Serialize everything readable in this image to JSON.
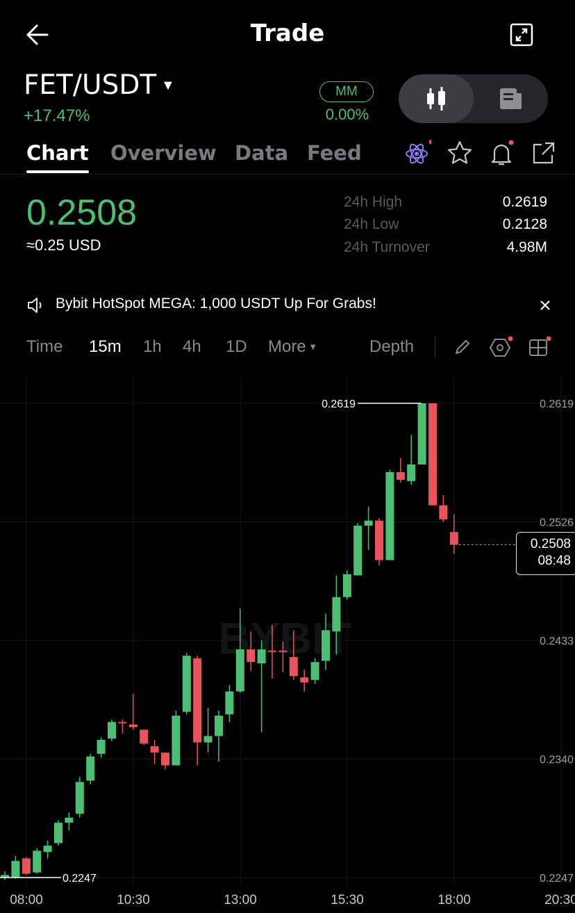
{
  "header": {
    "title": "Trade"
  },
  "pair": {
    "symbol": "FET/USDT",
    "change": "+17.47%"
  },
  "mm": {
    "label": "MM",
    "value": "0.00%"
  },
  "tabs": [
    "Chart",
    "Overview",
    "Data",
    "Feed"
  ],
  "price": {
    "last": "0.2508",
    "usd": "≈0.25 USD"
  },
  "stats": [
    {
      "label": "24h High",
      "value": "0.2619"
    },
    {
      "label": "24h Low",
      "value": "0.2128"
    },
    {
      "label": "24h Turnover",
      "value": "4.98M"
    }
  ],
  "announcement": "Bybit HotSpot MEGA: 1,000 USDT Up For Grabs!",
  "timeframes": {
    "time": "Time",
    "m15": "15m",
    "h1": "1h",
    "h4": "4h",
    "d1": "1D",
    "more": "More",
    "depth": "Depth"
  },
  "colors": {
    "up": "#4cbf73",
    "down": "#e9545c",
    "bg": "#000000"
  },
  "chart_data": {
    "type": "candlestick",
    "interval": "15m",
    "watermark": "BYBIT",
    "y_ticks": [
      "0.2619",
      "0.2526",
      "0.2433",
      "0.2340",
      "0.2247"
    ],
    "ylim": [
      0.2247,
      0.2619
    ],
    "x_ticks": [
      "08:00",
      "10:30",
      "13:00",
      "15:30",
      "18:00",
      "20:30"
    ],
    "high_marker": "0.2619",
    "low_marker": "0.2247",
    "current_price": "0.2508",
    "countdown": "08:48",
    "candles": [
      {
        "o": 0.2247,
        "h": 0.2252,
        "l": 0.2245,
        "c": 0.2249
      },
      {
        "o": 0.2247,
        "h": 0.2264,
        "l": 0.2246,
        "c": 0.226
      },
      {
        "o": 0.2262,
        "h": 0.2263,
        "l": 0.2249,
        "c": 0.225
      },
      {
        "o": 0.2251,
        "h": 0.227,
        "l": 0.225,
        "c": 0.2268
      },
      {
        "o": 0.2267,
        "h": 0.2276,
        "l": 0.2262,
        "c": 0.2272
      },
      {
        "o": 0.2274,
        "h": 0.2292,
        "l": 0.2272,
        "c": 0.229
      },
      {
        "o": 0.229,
        "h": 0.2298,
        "l": 0.2284,
        "c": 0.2294
      },
      {
        "o": 0.2297,
        "h": 0.2326,
        "l": 0.2294,
        "c": 0.2322
      },
      {
        "o": 0.2323,
        "h": 0.2344,
        "l": 0.232,
        "c": 0.2342
      },
      {
        "o": 0.2344,
        "h": 0.2357,
        "l": 0.2341,
        "c": 0.2355
      },
      {
        "o": 0.2356,
        "h": 0.2371,
        "l": 0.2354,
        "c": 0.2369
      },
      {
        "o": 0.2369,
        "h": 0.2371,
        "l": 0.236,
        "c": 0.2368
      },
      {
        "o": 0.2367,
        "h": 0.2391,
        "l": 0.2363,
        "c": 0.2365
      },
      {
        "o": 0.2363,
        "h": 0.2363,
        "l": 0.2351,
        "c": 0.2352
      },
      {
        "o": 0.235,
        "h": 0.2355,
        "l": 0.2336,
        "c": 0.2345
      },
      {
        "o": 0.2345,
        "h": 0.2345,
        "l": 0.2332,
        "c": 0.2335
      },
      {
        "o": 0.2335,
        "h": 0.2378,
        "l": 0.2335,
        "c": 0.2374
      },
      {
        "o": 0.2377,
        "h": 0.2423,
        "l": 0.2375,
        "c": 0.2421
      },
      {
        "o": 0.2419,
        "h": 0.2421,
        "l": 0.2335,
        "c": 0.2353
      },
      {
        "o": 0.2353,
        "h": 0.238,
        "l": 0.2345,
        "c": 0.2358
      },
      {
        "o": 0.2358,
        "h": 0.2378,
        "l": 0.2338,
        "c": 0.2374
      },
      {
        "o": 0.2375,
        "h": 0.2398,
        "l": 0.2369,
        "c": 0.2393
      },
      {
        "o": 0.2393,
        "h": 0.2458,
        "l": 0.2392,
        "c": 0.2426
      },
      {
        "o": 0.2426,
        "h": 0.244,
        "l": 0.2409,
        "c": 0.2416
      },
      {
        "o": 0.2415,
        "h": 0.2433,
        "l": 0.2361,
        "c": 0.2426
      },
      {
        "o": 0.2425,
        "h": 0.2445,
        "l": 0.2403,
        "c": 0.2424
      },
      {
        "o": 0.2425,
        "h": 0.2432,
        "l": 0.2408,
        "c": 0.2424
      },
      {
        "o": 0.242,
        "h": 0.2441,
        "l": 0.2402,
        "c": 0.2405
      },
      {
        "o": 0.2404,
        "h": 0.241,
        "l": 0.2393,
        "c": 0.24
      },
      {
        "o": 0.2402,
        "h": 0.2419,
        "l": 0.2399,
        "c": 0.2416
      },
      {
        "o": 0.2417,
        "h": 0.2454,
        "l": 0.241,
        "c": 0.2441
      },
      {
        "o": 0.244,
        "h": 0.2484,
        "l": 0.2422,
        "c": 0.2467
      },
      {
        "o": 0.2467,
        "h": 0.2488,
        "l": 0.2465,
        "c": 0.2485
      },
      {
        "o": 0.2484,
        "h": 0.2525,
        "l": 0.2484,
        "c": 0.2523
      },
      {
        "o": 0.2523,
        "h": 0.2538,
        "l": 0.2504,
        "c": 0.2527
      },
      {
        "o": 0.2527,
        "h": 0.2529,
        "l": 0.2492,
        "c": 0.2496
      },
      {
        "o": 0.2496,
        "h": 0.2567,
        "l": 0.2496,
        "c": 0.2565
      },
      {
        "o": 0.2565,
        "h": 0.2576,
        "l": 0.2557,
        "c": 0.2559
      },
      {
        "o": 0.2558,
        "h": 0.2594,
        "l": 0.2555,
        "c": 0.2571
      },
      {
        "o": 0.2571,
        "h": 0.2619,
        "l": 0.2571,
        "c": 0.2619
      },
      {
        "o": 0.2619,
        "h": 0.2619,
        "l": 0.2539,
        "c": 0.2539
      },
      {
        "o": 0.2539,
        "h": 0.2547,
        "l": 0.2526,
        "c": 0.2528
      },
      {
        "o": 0.2518,
        "h": 0.2532,
        "l": 0.2501,
        "c": 0.2508
      }
    ]
  }
}
